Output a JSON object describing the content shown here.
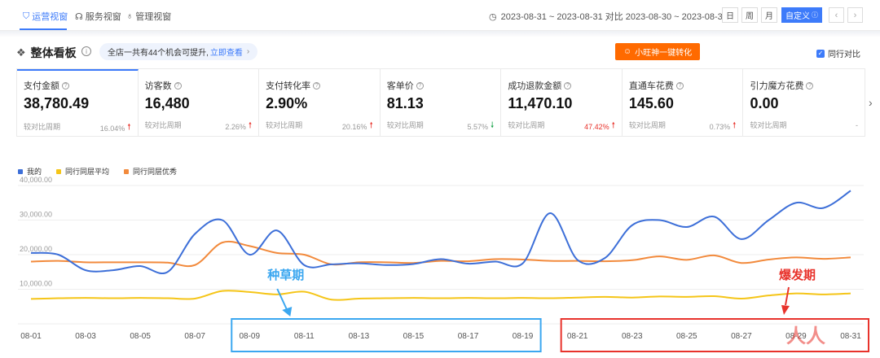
{
  "topbar": {
    "tabs": [
      {
        "label": "运营视窗",
        "icon": "shield-icon",
        "active": true
      },
      {
        "label": "服务视窗",
        "icon": "headset-icon",
        "active": false
      },
      {
        "label": "管理视窗",
        "icon": "flask-icon",
        "active": false
      }
    ],
    "date_range": "2023-08-31 ~ 2023-08-31 对比 2023-08-30 ~ 2023-08-30",
    "period_buttons": [
      "日",
      "周",
      "月"
    ],
    "custom_button": "自定义",
    "prev_icon": "chevron-left-icon",
    "next_icon": "chevron-right-icon"
  },
  "board": {
    "title": "整体看板",
    "tip_text": "全店一共有44个机会可提升,",
    "tip_link": "立即查看",
    "convert_button": "小旺神一键转化",
    "peer_compare_label": "同行对比"
  },
  "metrics": [
    {
      "label": "支付金额",
      "value": "38,780.49",
      "compare": "较对比周期",
      "change": "16.04%",
      "dir": "up"
    },
    {
      "label": "访客数",
      "value": "16,480",
      "compare": "较对比周期",
      "change": "2.26%",
      "dir": "up"
    },
    {
      "label": "支付转化率",
      "value": "2.90%",
      "compare": "较对比周期",
      "change": "20.16%",
      "dir": "up"
    },
    {
      "label": "客单价",
      "value": "81.13",
      "compare": "较对比周期",
      "change": "5.57%",
      "dir": "down"
    },
    {
      "label": "成功退款金额",
      "value": "11,470.10",
      "compare": "较对比周期",
      "change": "47.42%",
      "dir": "up",
      "red": true
    },
    {
      "label": "直通车花费",
      "value": "145.60",
      "compare": "较对比周期",
      "change": "0.73%",
      "dir": "up"
    },
    {
      "label": "引力魔方花费",
      "value": "0.00",
      "compare": "较对比周期",
      "change": "-",
      "dir": "none"
    }
  ],
  "annotations": {
    "seeding": "种草期",
    "burst": "爆发期",
    "watermark": "人人都是产品经理"
  },
  "colors": {
    "accent": "#3d7bfa",
    "orange": "#ff6a00",
    "series_mine": "#3d6fd8",
    "series_avg": "#f5c518",
    "series_top": "#f28a3c",
    "seed_box": "#3ba7f0",
    "burst_box": "#e8332c"
  },
  "chart_data": {
    "type": "line",
    "x": [
      "08-01",
      "08-02",
      "08-03",
      "08-04",
      "08-05",
      "08-06",
      "08-07",
      "08-08",
      "08-09",
      "08-10",
      "08-11",
      "08-12",
      "08-13",
      "08-14",
      "08-15",
      "08-16",
      "08-17",
      "08-18",
      "08-19",
      "08-20",
      "08-21",
      "08-22",
      "08-23",
      "08-24",
      "08-25",
      "08-26",
      "08-27",
      "08-28",
      "08-29",
      "08-30",
      "08-31"
    ],
    "x_tick_labels": [
      "08-01",
      "08-03",
      "08-05",
      "08-07",
      "08-09",
      "08-11",
      "08-13",
      "08-15",
      "08-17",
      "08-19",
      "08-21",
      "08-23",
      "08-25",
      "08-27",
      "08-29",
      "08-31"
    ],
    "y_tick_labels": [
      "0",
      "10,000.00",
      "20,000.00",
      "30,000.00",
      "40,000.00"
    ],
    "ylim": [
      0,
      40000
    ],
    "grid": true,
    "legend_position": "top-left",
    "series": [
      {
        "name": "我的",
        "values": [
          20500,
          20000,
          15500,
          15500,
          16700,
          15000,
          26000,
          30000,
          20000,
          27000,
          17000,
          17200,
          17500,
          17000,
          17300,
          18700,
          17400,
          18000,
          17500,
          32000,
          18500,
          19000,
          28500,
          30000,
          28000,
          31000,
          24500,
          30000,
          35000,
          33500,
          38500
        ]
      },
      {
        "name": "同行同层平均",
        "values": [
          7200,
          7400,
          7500,
          7400,
          7500,
          7400,
          7300,
          9500,
          9200,
          8500,
          9300,
          7000,
          7300,
          7400,
          7500,
          7400,
          7500,
          7400,
          7500,
          7400,
          7600,
          7800,
          7600,
          7900,
          7800,
          8000,
          7300,
          8200,
          8800,
          8500,
          8800
        ]
      },
      {
        "name": "同行同层优秀",
        "values": [
          18000,
          18200,
          17800,
          17800,
          17800,
          17700,
          17000,
          23500,
          22500,
          20500,
          20000,
          17200,
          17800,
          17800,
          17600,
          18200,
          18100,
          18700,
          18600,
          18200,
          18200,
          18100,
          18400,
          19500,
          18500,
          19800,
          17600,
          18600,
          19200,
          18800,
          19200
        ]
      }
    ],
    "annotations": [
      {
        "label": "种草期",
        "x_from": "08-09",
        "x_to": "08-19"
      },
      {
        "label": "爆发期",
        "x_from": "08-21",
        "x_to": "08-31"
      }
    ]
  }
}
